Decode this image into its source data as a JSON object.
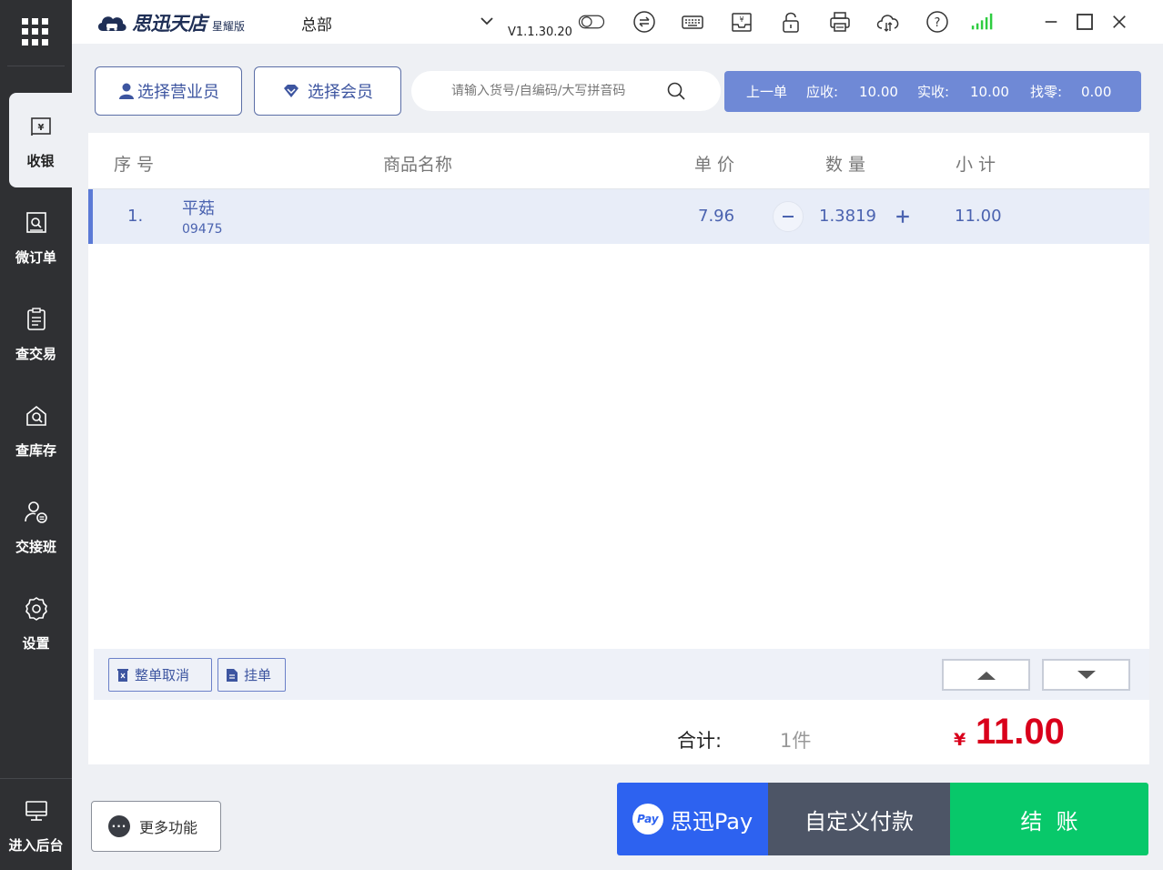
{
  "sidebar": {
    "items": [
      {
        "label": "收银",
        "icon": "cash-register-icon",
        "active": true
      },
      {
        "label": "微订单",
        "icon": "micro-order-icon"
      },
      {
        "label": "查交易",
        "icon": "transaction-list-icon"
      },
      {
        "label": "查库存",
        "icon": "inventory-icon"
      },
      {
        "label": "交接班",
        "icon": "shift-handover-icon"
      },
      {
        "label": "设置",
        "icon": "settings-gear-icon"
      }
    ],
    "backend": {
      "label": "进入后台",
      "icon": "monitor-icon"
    }
  },
  "topbar": {
    "logo_text": "思迅天店",
    "logo_edition": "星耀版",
    "store": "总部",
    "version": "V1.1.30.20",
    "icons": [
      "toggle-icon",
      "exchange-icon",
      "keyboard-icon",
      "cash-drawer-icon",
      "lock-icon",
      "printer-icon",
      "cloud-sync-icon",
      "help-icon",
      "signal-icon"
    ],
    "signal_color": "#2ecc40"
  },
  "actions": {
    "select_staff": "选择营业员",
    "select_member": "选择会员",
    "search_placeholder": "请输入货号/自编码/大写拼音码",
    "last_order": {
      "label": "上一单",
      "due_label": "应收:",
      "due": "10.00",
      "paid_label": "实收:",
      "paid": "10.00",
      "change_label": "找零:",
      "change": "0.00"
    }
  },
  "table": {
    "headers": {
      "no": "序 号",
      "name": "商品名称",
      "price": "单 价",
      "qty": "数 量",
      "subtotal": "小 计"
    },
    "rows": [
      {
        "no": "1.",
        "name": "平菇",
        "code": "09475",
        "price": "7.96",
        "qty": "1.3819",
        "subtotal": "11.00"
      }
    ]
  },
  "toolbar": {
    "cancel_all": "整单取消",
    "hold": "挂单"
  },
  "summary": {
    "total_label": "合计:",
    "count": "1件",
    "currency": "¥",
    "amount": "11.00"
  },
  "bottom": {
    "more": "更多功能",
    "sixun_pay_logo": "Pay",
    "sixun_pay": "思迅Pay",
    "custom_pay": "自定义付款",
    "checkout": "结  账"
  },
  "colors": {
    "sidebar": "#2f3033",
    "accent": "#6f89d6",
    "amount": "#d9001b",
    "checkout": "#08c86a",
    "pay_blue": "#2d62f0",
    "custom_pay": "#4d5566"
  }
}
